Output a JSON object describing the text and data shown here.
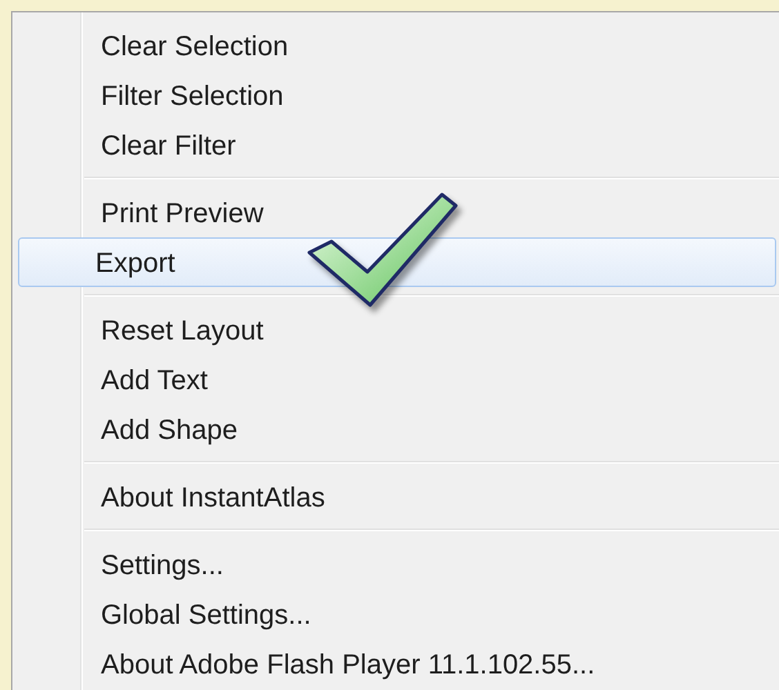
{
  "menu": {
    "groups": [
      {
        "items": [
          {
            "label": "Clear Selection",
            "selected": false
          },
          {
            "label": "Filter Selection",
            "selected": false
          },
          {
            "label": "Clear Filter",
            "selected": false
          }
        ]
      },
      {
        "items": [
          {
            "label": "Print Preview",
            "selected": false
          },
          {
            "label": "Export",
            "selected": true
          }
        ]
      },
      {
        "items": [
          {
            "label": "Reset Layout",
            "selected": false
          },
          {
            "label": "Add Text",
            "selected": false
          },
          {
            "label": "Add Shape",
            "selected": false
          }
        ]
      },
      {
        "items": [
          {
            "label": "About InstantAtlas",
            "selected": false
          }
        ]
      },
      {
        "items": [
          {
            "label": "Settings...",
            "selected": false
          },
          {
            "label": "Global Settings...",
            "selected": false
          },
          {
            "label": "About Adobe Flash Player 11.1.102.55...",
            "selected": false
          }
        ]
      }
    ]
  }
}
